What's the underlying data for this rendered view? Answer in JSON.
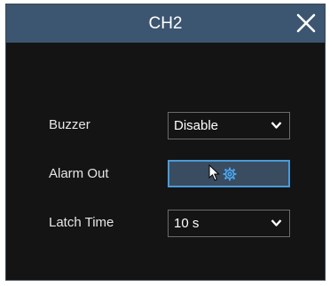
{
  "dialog": {
    "title": "CH2",
    "close_icon": "close-icon"
  },
  "rows": {
    "buzzer": {
      "label": "Buzzer",
      "value": "Disable"
    },
    "alarm_out": {
      "label": "Alarm Out",
      "button_icon": "gear-icon"
    },
    "latch_time": {
      "label": "Latch Time",
      "value": "10 s"
    }
  },
  "colors": {
    "titlebar": "#3c5570",
    "background": "#141414",
    "accent": "#4a9ad8"
  }
}
